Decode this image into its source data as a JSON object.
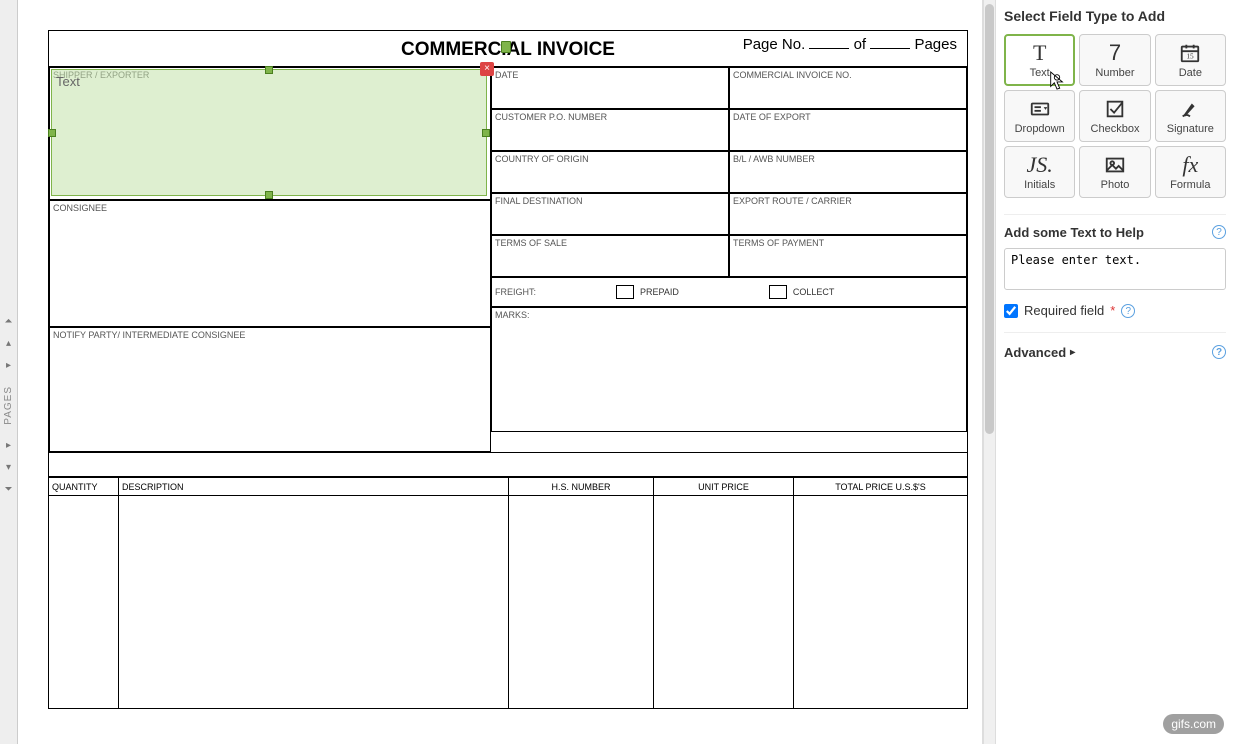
{
  "leftRail": {
    "label": "PAGES"
  },
  "doc": {
    "title": "COMMERCIAL INVOICE",
    "pageNo": "Page No.",
    "of": "of",
    "pages": "Pages",
    "shipperExporter": "SHIPPER / EXPORTER",
    "consignee": "CONSIGNEE",
    "notify": "NOTIFY PARTY/ INTERMEDIATE CONSIGNEE",
    "date": "DATE",
    "invoiceNo": "COMMERCIAL INVOICE NO.",
    "po": "CUSTOMER P.O. NUMBER",
    "dateExport": "DATE OF EXPORT",
    "origin": "COUNTRY OF ORIGIN",
    "awb": "B/L / AWB NUMBER",
    "finalDest": "FINAL DESTINATION",
    "route": "EXPORT ROUTE / CARRIER",
    "termsSale": "TERMS OF SALE",
    "termsPay": "TERMS OF PAYMENT",
    "freight": "FREIGHT:",
    "prepaid": "PREPAID",
    "collect": "COLLECT",
    "marks": "MARKS:",
    "cols": {
      "qty": "QUANTITY",
      "desc": "DESCRIPTION",
      "hs": "H.S. NUMBER",
      "up": "UNIT PRICE",
      "tp": "TOTAL PRICE U.S.$'S"
    }
  },
  "field": {
    "label": "Text"
  },
  "panel": {
    "title": "Select Field Type to Add",
    "types": {
      "text": "Text",
      "number": "Number",
      "date": "Date",
      "dropdown": "Dropdown",
      "checkbox": "Checkbox",
      "signature": "Signature",
      "initials": "Initials",
      "photo": "Photo",
      "formula": "Formula"
    },
    "helpTitle": "Add some Text to Help",
    "helpValue": "Please enter text.",
    "required": "Required field",
    "advanced": "Advanced"
  },
  "watermark": "gifs.com"
}
